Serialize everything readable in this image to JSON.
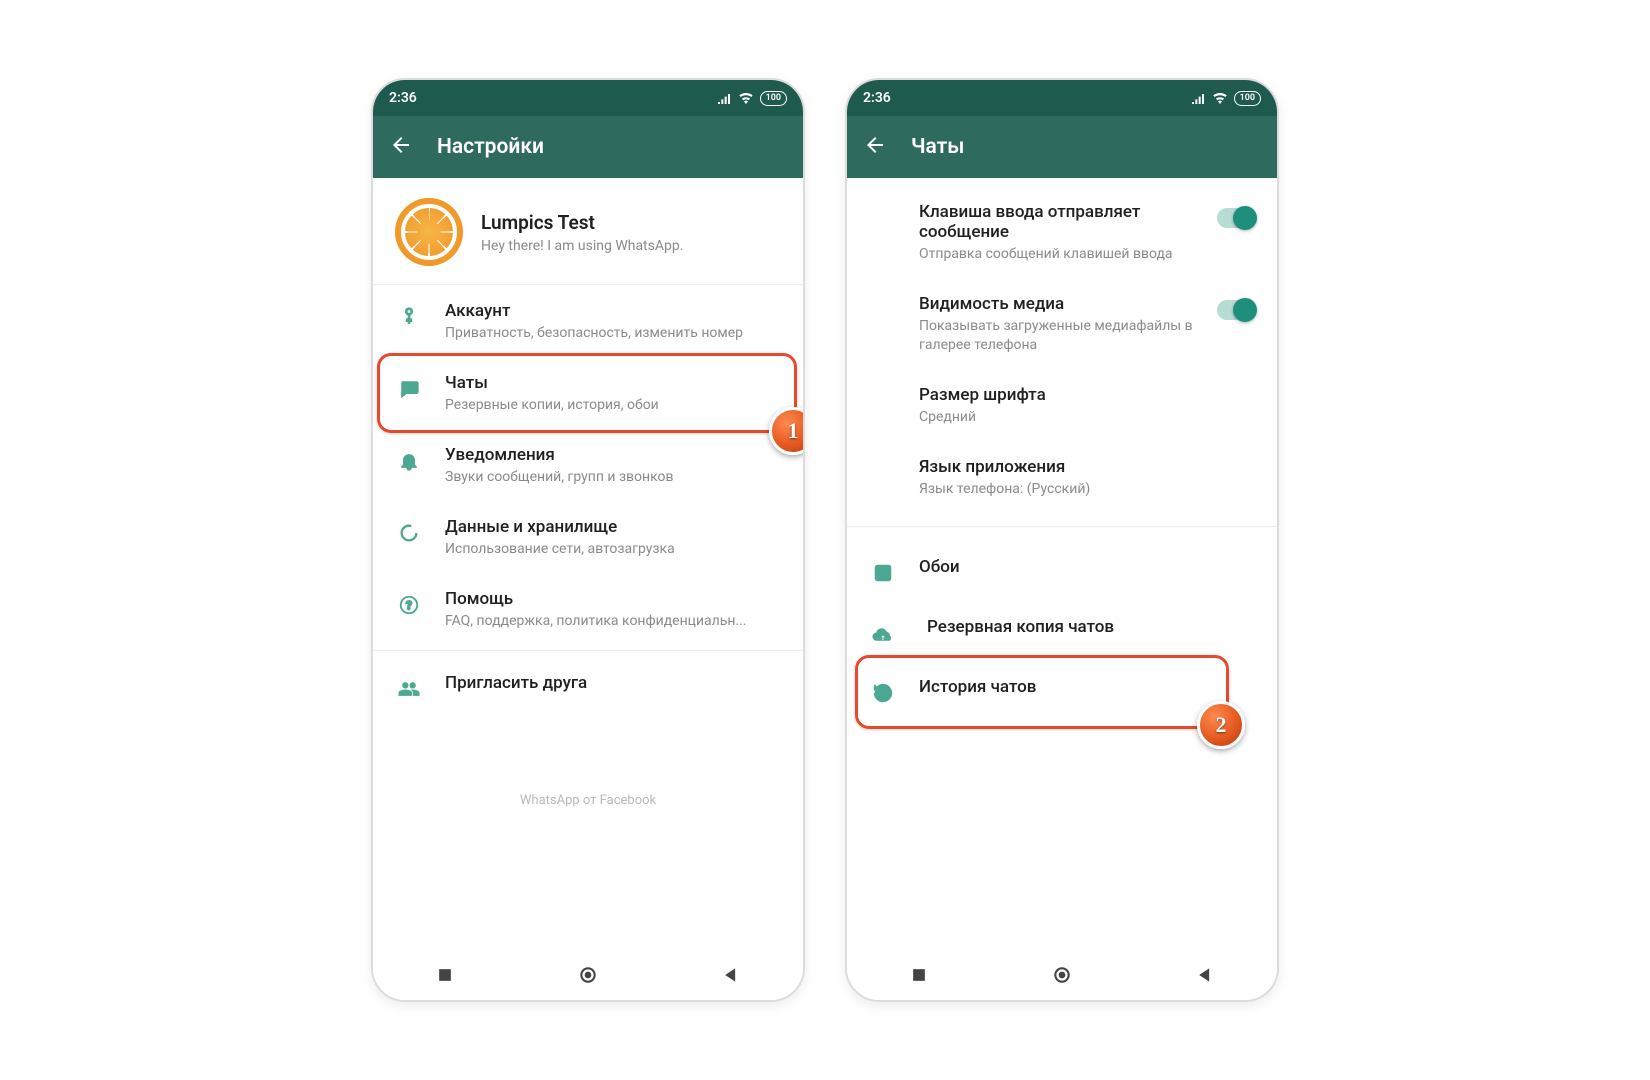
{
  "statusbar": {
    "time": "2:36",
    "battery": "100"
  },
  "screen_left": {
    "title": "Настройки",
    "profile": {
      "name": "Lumpics Test",
      "status": "Hey there! I am using WhatsApp."
    },
    "items": [
      {
        "title": "Аккаунт",
        "sub": "Приватность, безопасность, изменить номер"
      },
      {
        "title": "Чаты",
        "sub": "Резервные копии, история, обои"
      },
      {
        "title": "Уведомления",
        "sub": "Звуки сообщений, групп и звонков"
      },
      {
        "title": "Данные и хранилище",
        "sub": "Использование сети, автозагрузка"
      },
      {
        "title": "Помощь",
        "sub": "FAQ, поддержка, политика конфиденциальн..."
      },
      {
        "title": "Пригласить друга"
      }
    ],
    "footer": "WhatsApp от Facebook",
    "step_badge": "1"
  },
  "screen_right": {
    "title": "Чаты",
    "items": [
      {
        "title": "Клавиша ввода отправляет сообщение",
        "sub": "Отправка сообщений клавишей ввода"
      },
      {
        "title": "Видимость медиа",
        "sub": "Показывать загруженные медиафайлы в галерее телефона"
      },
      {
        "title": "Размер шрифта",
        "sub": "Средний"
      },
      {
        "title": "Язык приложения",
        "sub": "Язык телефона: (Русский)"
      },
      {
        "title": "Обои"
      },
      {
        "title": "Резервная копия чатов"
      },
      {
        "title": "История чатов"
      }
    ],
    "step_badge": "2"
  }
}
